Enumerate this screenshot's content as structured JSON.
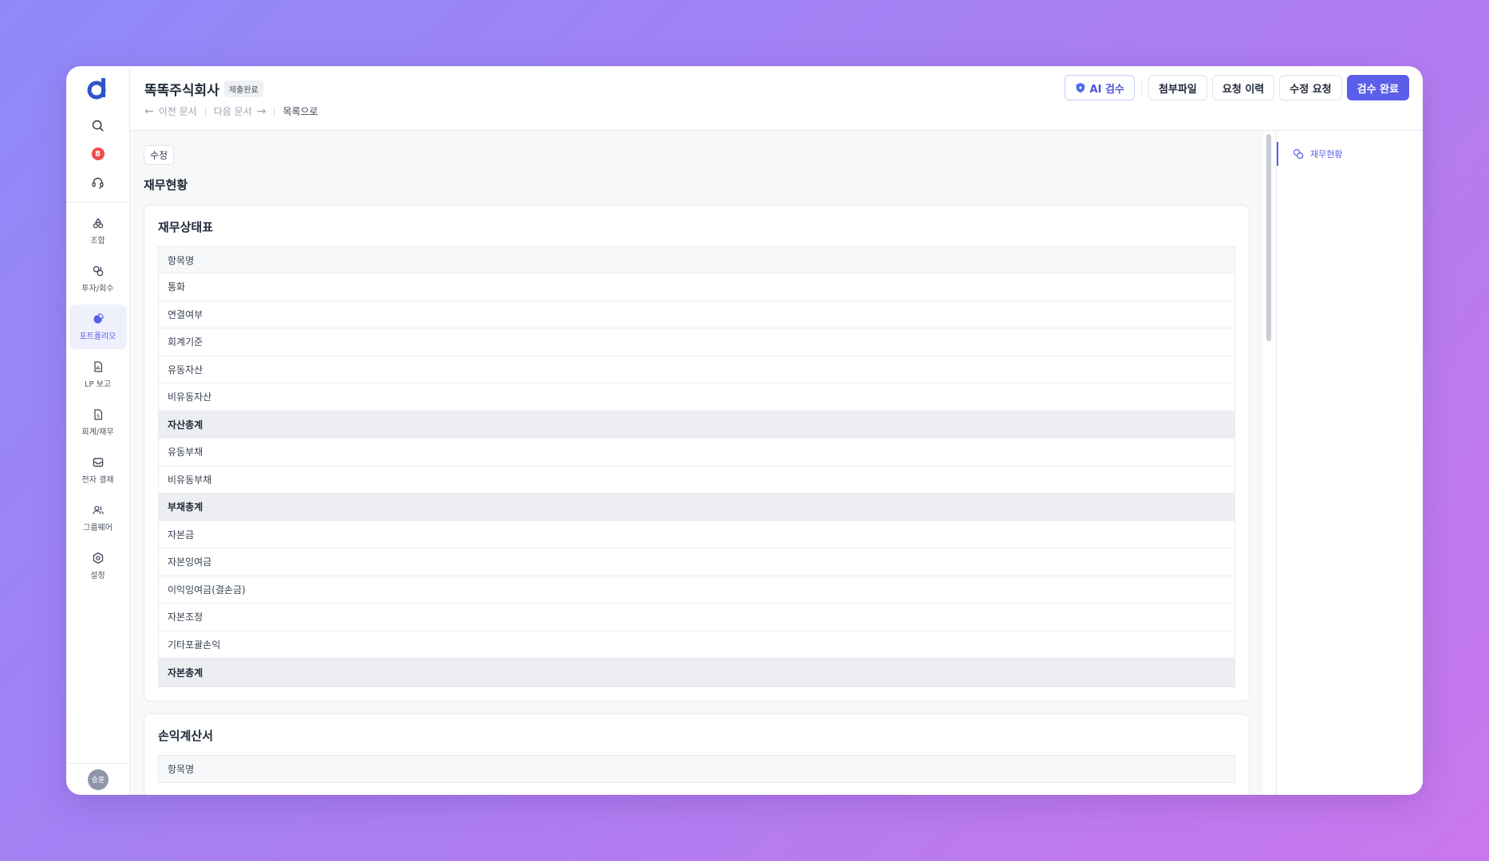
{
  "sidebar": {
    "notification_count": "8",
    "nav": [
      {
        "label": "조합",
        "icon": "recycle-icon"
      },
      {
        "label": "투자/회수",
        "icon": "investment-icon"
      },
      {
        "label": "포트폴리오",
        "icon": "pie-chart-icon",
        "active": true
      },
      {
        "label": "LP 보고",
        "icon": "report-icon"
      },
      {
        "label": "회계/재무",
        "icon": "accounting-icon"
      },
      {
        "label": "전자 결재",
        "icon": "inbox-icon"
      },
      {
        "label": "그룹웨어",
        "icon": "users-icon"
      },
      {
        "label": "설정",
        "icon": "gear-icon"
      }
    ],
    "user_initials": "승훈"
  },
  "header": {
    "company": "똑똑주식회사",
    "status": "제출완료",
    "prev_doc": "이전 문서",
    "next_doc": "다음 문서",
    "back_to_list": "목록으로",
    "actions": {
      "ai_review": "AI 검수",
      "attachments": "첨부파일",
      "request_history": "요청 이력",
      "revision_request": "수정 요청",
      "review_complete": "검수 완료"
    }
  },
  "content": {
    "edit_label": "수정",
    "section_title": "재무현황",
    "balance_sheet": {
      "title": "재무상태표",
      "header": "항목명",
      "rows": [
        {
          "label": "통화",
          "total": false
        },
        {
          "label": "연결여부",
          "total": false
        },
        {
          "label": "회계기준",
          "total": false
        },
        {
          "label": "유동자산",
          "total": false
        },
        {
          "label": "비유동자산",
          "total": false
        },
        {
          "label": "자산총계",
          "total": true
        },
        {
          "label": "유동부채",
          "total": false
        },
        {
          "label": "비유동부채",
          "total": false
        },
        {
          "label": "부채총계",
          "total": true
        },
        {
          "label": "자본금",
          "total": false
        },
        {
          "label": "자본잉여금",
          "total": false
        },
        {
          "label": "이익잉여금(결손금)",
          "total": false
        },
        {
          "label": "자본조정",
          "total": false
        },
        {
          "label": "기타포괄손익",
          "total": false
        },
        {
          "label": "자본총계",
          "total": true
        }
      ]
    },
    "income_statement": {
      "title": "손익계산서",
      "header": "항목명"
    }
  },
  "toc": {
    "items": [
      {
        "label": "재무현황"
      }
    ]
  },
  "colors": {
    "accent": "#5b5ee8",
    "badge": "#ef4b4b"
  }
}
